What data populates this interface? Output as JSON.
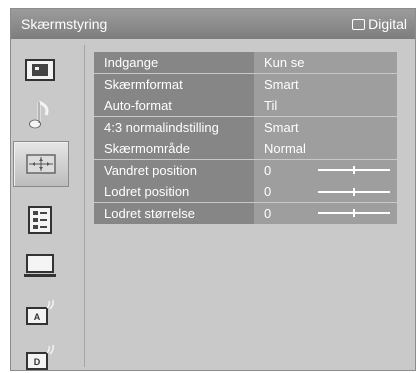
{
  "window": {
    "title": "Skærmstyring",
    "source_label": "Digital",
    "source_icon": "screen-outline-icon"
  },
  "sidebar": {
    "items": [
      {
        "name": "picture-icon",
        "active": false
      },
      {
        "name": "sound-note-icon",
        "active": false
      },
      {
        "name": "screen-control-icon",
        "active": true
      },
      {
        "name": "features-list-icon",
        "active": false
      },
      {
        "name": "monitor-icon",
        "active": false
      },
      {
        "name": "analog-setup-icon",
        "active": false,
        "glyph": "A"
      },
      {
        "name": "digital-setup-icon",
        "active": false,
        "glyph": "D"
      }
    ]
  },
  "menu": {
    "rows": [
      {
        "label": "Indgange",
        "value": "Kun se"
      },
      {
        "label": "Skærmformat",
        "value": "Smart"
      },
      {
        "label": "Auto-format",
        "value": "Til"
      },
      {
        "label": "4:3 normalindstilling",
        "value": "Smart"
      },
      {
        "label": "Skærmområde",
        "value": "Normal"
      },
      {
        "label": "Vandret position",
        "value": "0",
        "slider_level": 0.5
      },
      {
        "label": "Lodret position",
        "value": "0",
        "slider_level": 0.5
      },
      {
        "label": "Lodret størrelse",
        "value": "0",
        "slider_level": 0.5
      }
    ]
  },
  "colors": {
    "panel": "#c9c9c9",
    "row_label_bg": "#868686",
    "row_value_bg": "#9e9e9e",
    "text": "#ffffff"
  }
}
